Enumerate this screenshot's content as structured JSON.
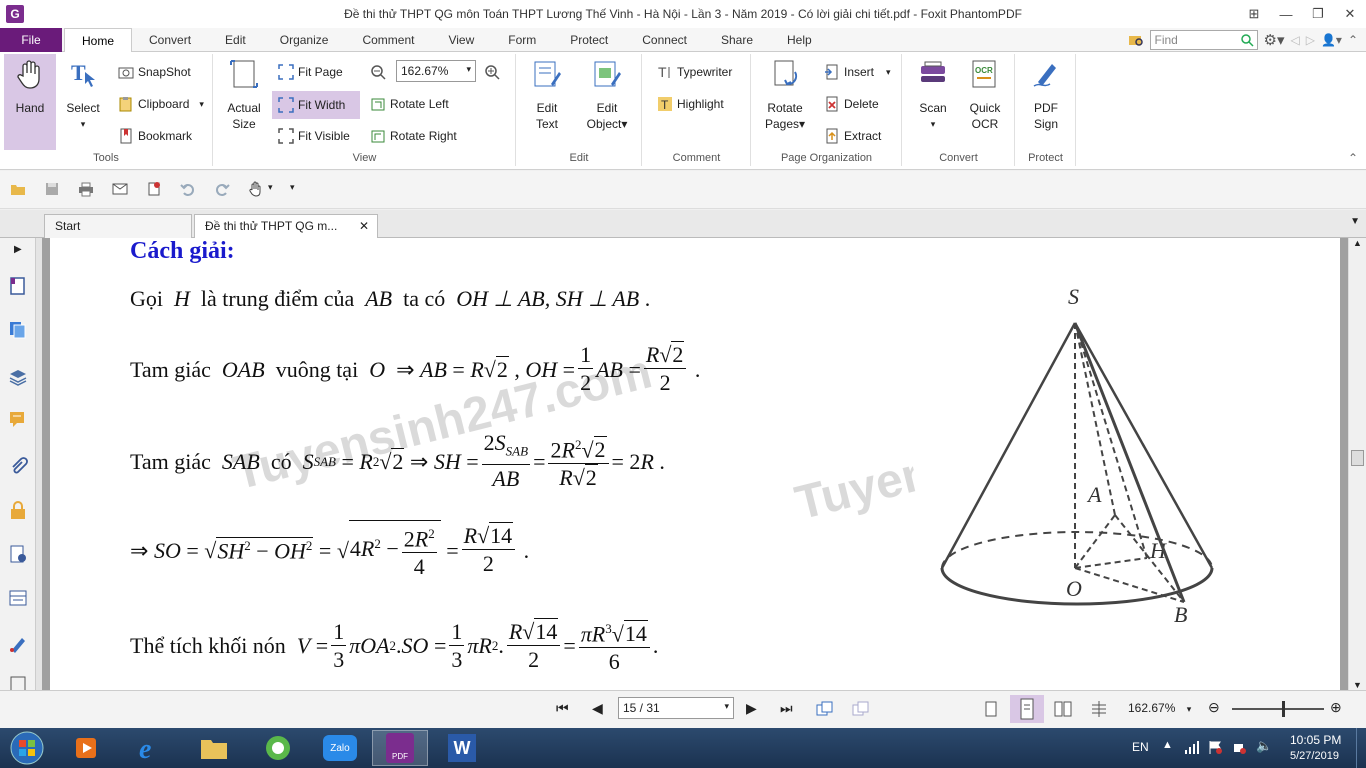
{
  "window": {
    "title": "Đề thi thử THPT QG môn Toán THPT Lương Thế Vinh - Hà Nội - Lần 3 - Năm 2019 - Có lời giải chi tiết.pdf - Foxit PhantomPDF",
    "app_icon_letter": "G"
  },
  "menu": {
    "file": "File",
    "tabs": [
      "Home",
      "Convert",
      "Edit",
      "Organize",
      "Comment",
      "View",
      "Form",
      "Protect",
      "Connect",
      "Share",
      "Help"
    ],
    "find_placeholder": "Find"
  },
  "ribbon": {
    "tools": {
      "label": "Tools",
      "hand": "Hand",
      "select": "Select",
      "snapshot": "SnapShot",
      "clipboard": "Clipboard",
      "bookmark": "Bookmark"
    },
    "view": {
      "label": "View",
      "actual_size_1": "Actual",
      "actual_size_2": "Size",
      "fit_page": "Fit Page",
      "fit_width": "Fit Width",
      "fit_visible": "Fit Visible",
      "zoom": "162.67%",
      "rotate_left": "Rotate Left",
      "rotate_right": "Rotate Right"
    },
    "edit": {
      "label": "Edit",
      "edit_text_1": "Edit",
      "edit_text_2": "Text",
      "edit_object_1": "Edit",
      "edit_object_2": "Object"
    },
    "comment": {
      "label": "Comment",
      "typewriter": "Typewriter",
      "highlight": "Highlight"
    },
    "page_org": {
      "label": "Page Organization",
      "rotate_pages_1": "Rotate",
      "rotate_pages_2": "Pages",
      "insert": "Insert",
      "delete": "Delete",
      "extract": "Extract"
    },
    "convert": {
      "label": "Convert",
      "scan": "Scan",
      "quick_ocr_1": "Quick",
      "quick_ocr_2": "OCR"
    },
    "protect": {
      "label": "Protect",
      "pdf_sign_1": "PDF",
      "pdf_sign_2": "Sign"
    }
  },
  "doc_tabs": {
    "start": "Start",
    "current": "Đề thi thử THPT QG m..."
  },
  "content": {
    "heading": "Cách giải:",
    "l1_text": "Gọi",
    "l1_H": "H",
    "l1_mid": "là trung điểm của",
    "l1_AB": "AB",
    "l1_taco": "ta có",
    "l1_rel": "OH ⊥ AB, SH ⊥ AB",
    "l2_text": "Tam giác",
    "l2_OAB": "OAB",
    "l2_vuong": "vuông tại",
    "l2_O": "O",
    "l3_text": "Tam giác",
    "l3_SAB": "SAB",
    "l3_co": "có",
    "l5_text": "Thể tích khối nón",
    "watermark_1": "Tuyensinh247.com",
    "watermark_2": "Tuyensinh247.com",
    "watermark_3": "Tuyen"
  },
  "figure_labels": {
    "S": "S",
    "A": "A",
    "H": "H",
    "O": "O",
    "B": "B"
  },
  "statusbar": {
    "page": "15 / 31",
    "zoom": "162.67%"
  },
  "taskbar": {
    "lang": "EN",
    "time": "10:05 PM",
    "date": "5/27/2019",
    "zalo": "Zalo",
    "pdf": "PDF"
  }
}
